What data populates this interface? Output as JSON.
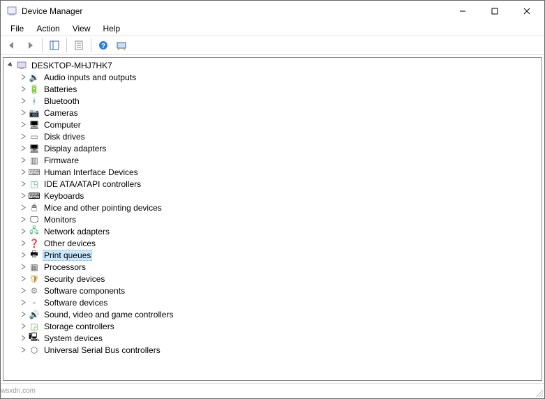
{
  "window": {
    "title": "Device Manager"
  },
  "menu": {
    "file": "File",
    "action": "Action",
    "view": "View",
    "help": "Help"
  },
  "toolbar": {
    "back": "back-icon",
    "forward": "forward-icon",
    "show_hide": "show-hide-tree-icon",
    "properties": "properties-icon",
    "help": "help-icon",
    "scan": "scan-hardware-icon"
  },
  "tree": {
    "root": "DESKTOP-MHJ7HK7",
    "selected": "Print queues",
    "categories": [
      {
        "label": "Audio inputs and outputs",
        "icon": "🔉"
      },
      {
        "label": "Batteries",
        "icon": "🔋"
      },
      {
        "label": "Bluetooth",
        "icon": "ᚼ",
        "iconColor": "#1e6fd8"
      },
      {
        "label": "Cameras",
        "icon": "📷"
      },
      {
        "label": "Computer",
        "icon": "🖥"
      },
      {
        "label": "Disk drives",
        "icon": "▭",
        "iconColor": "#777"
      },
      {
        "label": "Display adapters",
        "icon": "🖥"
      },
      {
        "label": "Firmware",
        "icon": "▥",
        "iconColor": "#555"
      },
      {
        "label": "Human Interface Devices",
        "icon": "⌨",
        "iconColor": "#666"
      },
      {
        "label": "IDE ATA/ATAPI controllers",
        "icon": "◳",
        "iconColor": "#4a7"
      },
      {
        "label": "Keyboards",
        "icon": "⌨"
      },
      {
        "label": "Mice and other pointing devices",
        "icon": "🖱"
      },
      {
        "label": "Monitors",
        "icon": "🖵"
      },
      {
        "label": "Network adapters",
        "icon": "🖧",
        "iconColor": "#3a7"
      },
      {
        "label": "Other devices",
        "icon": "❓",
        "iconColor": "#e0b030"
      },
      {
        "label": "Print queues",
        "icon": "🖶"
      },
      {
        "label": "Processors",
        "icon": "▦",
        "iconColor": "#666"
      },
      {
        "label": "Security devices",
        "icon": "🛡",
        "iconColor": "#c09020"
      },
      {
        "label": "Software components",
        "icon": "⚙",
        "iconColor": "#888"
      },
      {
        "label": "Software devices",
        "icon": "▫",
        "iconColor": "#888"
      },
      {
        "label": "Sound, video and game controllers",
        "icon": "🔊"
      },
      {
        "label": "Storage controllers",
        "icon": "◲",
        "iconColor": "#6a5"
      },
      {
        "label": "System devices",
        "icon": "🖳"
      },
      {
        "label": "Universal Serial Bus controllers",
        "icon": "⬡",
        "iconColor": "#555"
      }
    ]
  },
  "watermark": "wsxdn.com"
}
